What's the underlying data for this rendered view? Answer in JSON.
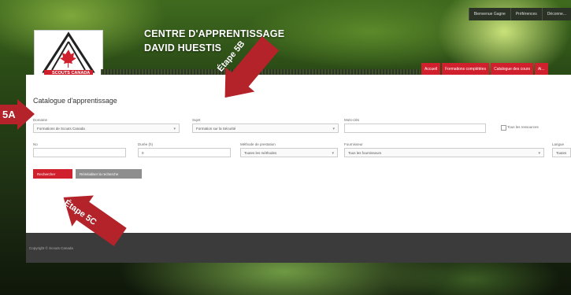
{
  "site": {
    "title_line1": "CENTRE D'APPRENTISSAGE",
    "title_line2": "DAVID HUESTIS",
    "logo_text": "SCOUTS CANADA"
  },
  "utility_nav": [
    "Bienvenue Gagne",
    "Préférences",
    "Déconne..."
  ],
  "main_nav": [
    "Accueil",
    "Formations complétées",
    "Catalogue des cours",
    "Ai..."
  ],
  "catalogue": {
    "page_title": "Catalogue d'apprentissage",
    "filters": {
      "domaine": {
        "label": "Domaine",
        "value": "Formations de Scouts Canada"
      },
      "sujet": {
        "label": "Sujet",
        "value": "Formation sur la Sécurité"
      },
      "mots_cles": {
        "label": "Mots-clés",
        "value": ""
      },
      "tous_ressources": {
        "label": "Tous les ressources"
      },
      "id": {
        "label": "No",
        "value": ""
      },
      "duree": {
        "label": "Durée (h)",
        "value": "0"
      },
      "methode": {
        "label": "Méthode de prestation",
        "value": "Toutes les méthodes"
      },
      "fournisseur": {
        "label": "Fournisseur",
        "value": "Tous les fournisseurs"
      },
      "langue": {
        "label": "Langue",
        "value": "Toutes"
      }
    },
    "buttons": {
      "search": "Rechercher",
      "reset": "Réinitialiser la recherche"
    }
  },
  "footer": {
    "copyright": "Copyright © Scouts Canada"
  },
  "callouts": {
    "step_5a": "5A",
    "step_5b": "Étape 5B",
    "step_5c": "Étape 5C"
  },
  "colors": {
    "brand_red": "#d0202e",
    "callout_red": "#b5232a",
    "footer_grey": "#3b3b3b"
  }
}
